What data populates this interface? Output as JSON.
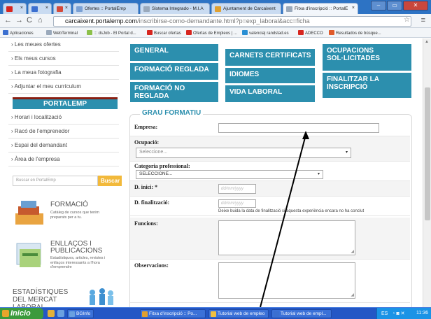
{
  "browser": {
    "tabs": [
      {
        "label": "",
        "icon": "youtube-icon",
        "color": "#d7261f"
      },
      {
        "label": "",
        "icon": "calendar-icon",
        "color": "#3b6fd0"
      },
      {
        "label": "",
        "icon": "gmail-icon",
        "color": "#d44a3a"
      },
      {
        "label": "Ofertes :: PortalEmp",
        "icon": "page-icon",
        "color": "#7aa0d4"
      },
      {
        "label": "Sistema Integrado - M.I.A",
        "icon": "page-icon",
        "color": "#9aa9bb"
      },
      {
        "label": "Ajuntament de Carcaixent",
        "icon": "site-icon",
        "color": "#e0a030"
      },
      {
        "label": "Fitxa d'inscripció :: PortalE",
        "icon": "page-icon",
        "color": "#9aa9bb"
      }
    ],
    "window_buttons": [
      "–",
      "▭",
      "✕"
    ],
    "url_host": "carcaixent.portalemp.com",
    "url_path": "/inscribirse-como-demandante.html?p=exp_laboral&acc=ficha",
    "bookmarks": [
      {
        "label": "Aplicaciones",
        "color": "#3b6fd0"
      },
      {
        "label": "WebTerminal",
        "color": "#9aa9bb"
      },
      {
        "label": "::: dsJob - El Portal d...",
        "color": "#8cc04a"
      },
      {
        "label": "Buscar ofertas",
        "color": "#d7261f"
      },
      {
        "label": "Ofertas de Empleos | ...",
        "color": "#d7261f"
      },
      {
        "label": "valencia| randstad.es",
        "color": "#2a8fd4"
      },
      {
        "label": "ADECCO",
        "color": "#d7261f"
      },
      {
        "label": "Resultados de búsque...",
        "color": "#e05a2a"
      }
    ]
  },
  "sidebar": {
    "items_top": [
      "Les meues ofertes",
      "Els meus cursos",
      "La meua fotografia",
      "Adjuntar el meu currículum"
    ],
    "section_title": "PORTALEMP",
    "items_bottom": [
      "Horari i localització",
      "Racó de l'emprenedor",
      "Espai del demandant",
      "Àrea de l'empresa"
    ],
    "search_placeholder": "Buscar en PortalEmp",
    "search_button": "Buscar",
    "promos": [
      {
        "title": "FORMACIÓ",
        "desc": "Catàleg de cursos que tenim preparats per a tu."
      },
      {
        "title": "ENLLAÇOS I PUBLICACIONS",
        "desc": "Estadístiques, articles, revistes i enllaços interessants a l'hora d'emprendre"
      },
      {
        "title": "ESTADÍSTIQUES DEL MERCAT LABORAL",
        "desc": ""
      }
    ]
  },
  "tabs": [
    "GENERAL",
    "CARNETS CERTIFICATS",
    "OCUPACIONS SOL·LICITADES",
    "FORMACIÓ REGLADA",
    "IDIOMES",
    "FINALITZAR LA INSCRIPCIÓ",
    "FORMACIÓ NO REGLADA",
    "VIDA LABORAL"
  ],
  "form": {
    "section_title": "GRAU FORMATIU",
    "empresa_label": "Empresa:",
    "ocupacio_label": "Ocupació:",
    "ocupacio_value": "Seleccione...",
    "categoria_label": "Categoria professional:",
    "categoria_value": "SELECCIONE...",
    "inici_label": "D. inici: *",
    "inici_placeholder": "dd/mm/yyyy",
    "final_label": "D. finalització:",
    "final_placeholder": "dd/mm/yyyy",
    "final_note": "Deixe buida la data de finalització si aquesta experiència encara no ha conclut",
    "funcions_label": "Funcions:",
    "observacions_label": "Observacions:"
  },
  "taskbar": {
    "start": "Inicio",
    "buttons": [
      {
        "label": "BGInfo",
        "color": "#6aa0e0"
      },
      {
        "label": "Fitxa d'inscripció :: Po...",
        "color": "#e0a030"
      },
      {
        "label": "Tutorial web de empleo",
        "color": "#f0c040"
      },
      {
        "label": "Tutorial web de empl...",
        "color": "#3b6fd0"
      }
    ],
    "lang": "ES",
    "time": "11:36"
  }
}
